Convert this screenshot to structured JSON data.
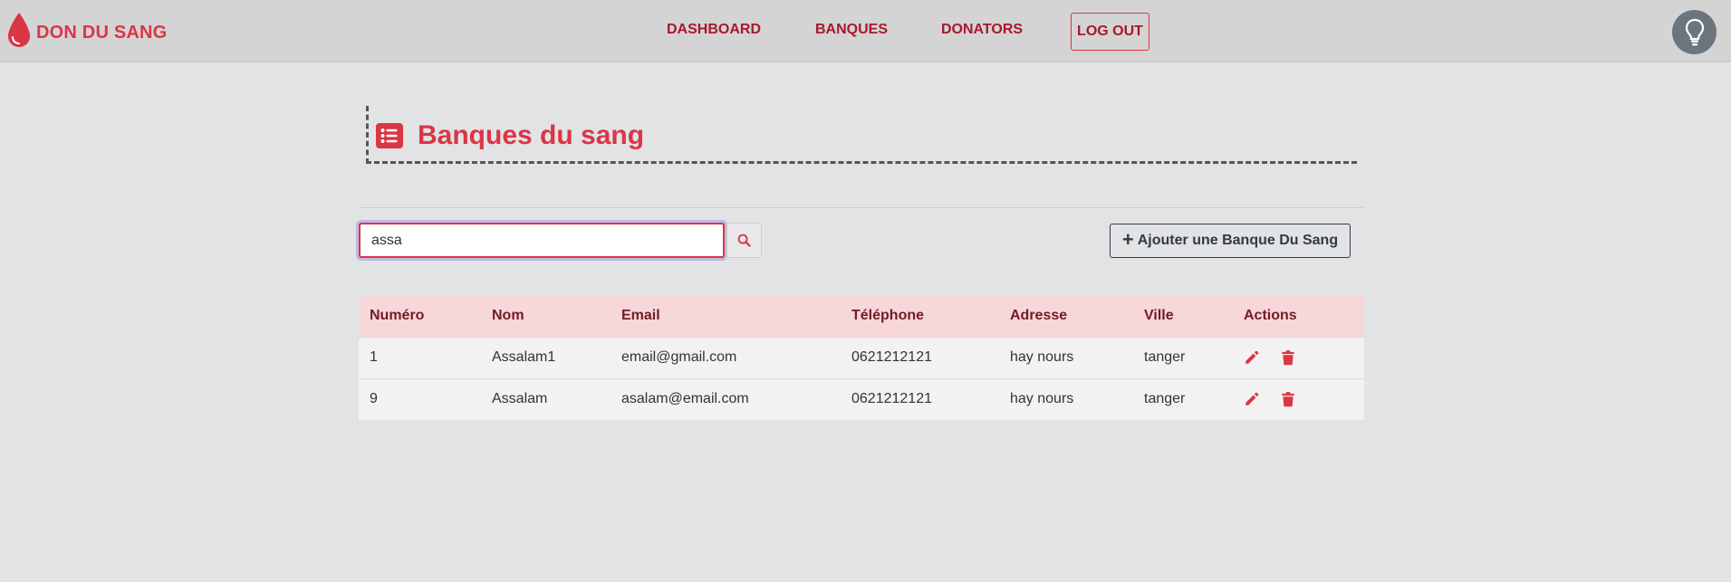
{
  "brand": {
    "name": "DON DU SANG"
  },
  "nav": {
    "dashboard": "DASHBOARD",
    "banques": "BANQUES",
    "donators": "DONATORS",
    "logout": "LOG OUT"
  },
  "page": {
    "title": "Banques du sang"
  },
  "search": {
    "value": "assa"
  },
  "actions": {
    "add_label": "Ajouter une Banque Du Sang"
  },
  "table": {
    "headers": [
      "Numéro",
      "Nom",
      "Email",
      "Téléphone",
      "Adresse",
      "Ville",
      "Actions"
    ],
    "rows": [
      {
        "numero": "1",
        "nom": "Assalam1",
        "email": "email@gmail.com",
        "telephone": "0621212121",
        "adresse": "hay nours",
        "ville": "tanger"
      },
      {
        "numero": "9",
        "nom": "Assalam",
        "email": "asalam@email.com",
        "telephone": "0621212121",
        "adresse": "hay nours",
        "ville": "tanger"
      }
    ]
  },
  "icons": {
    "brand": "blood-drop-icon",
    "help": "lightbulb-icon",
    "heading": "list-icon",
    "search": "search-icon",
    "add": "plus-icon",
    "edit": "pencil-icon",
    "delete": "trash-icon"
  },
  "colors": {
    "accent": "#dc3545",
    "nav_text": "#a8182a",
    "table_header_bg": "#f8d7da",
    "table_header_text": "#721c24",
    "navbar_bg": "#d4d4d4",
    "page_bg": "#e2e3e5"
  }
}
